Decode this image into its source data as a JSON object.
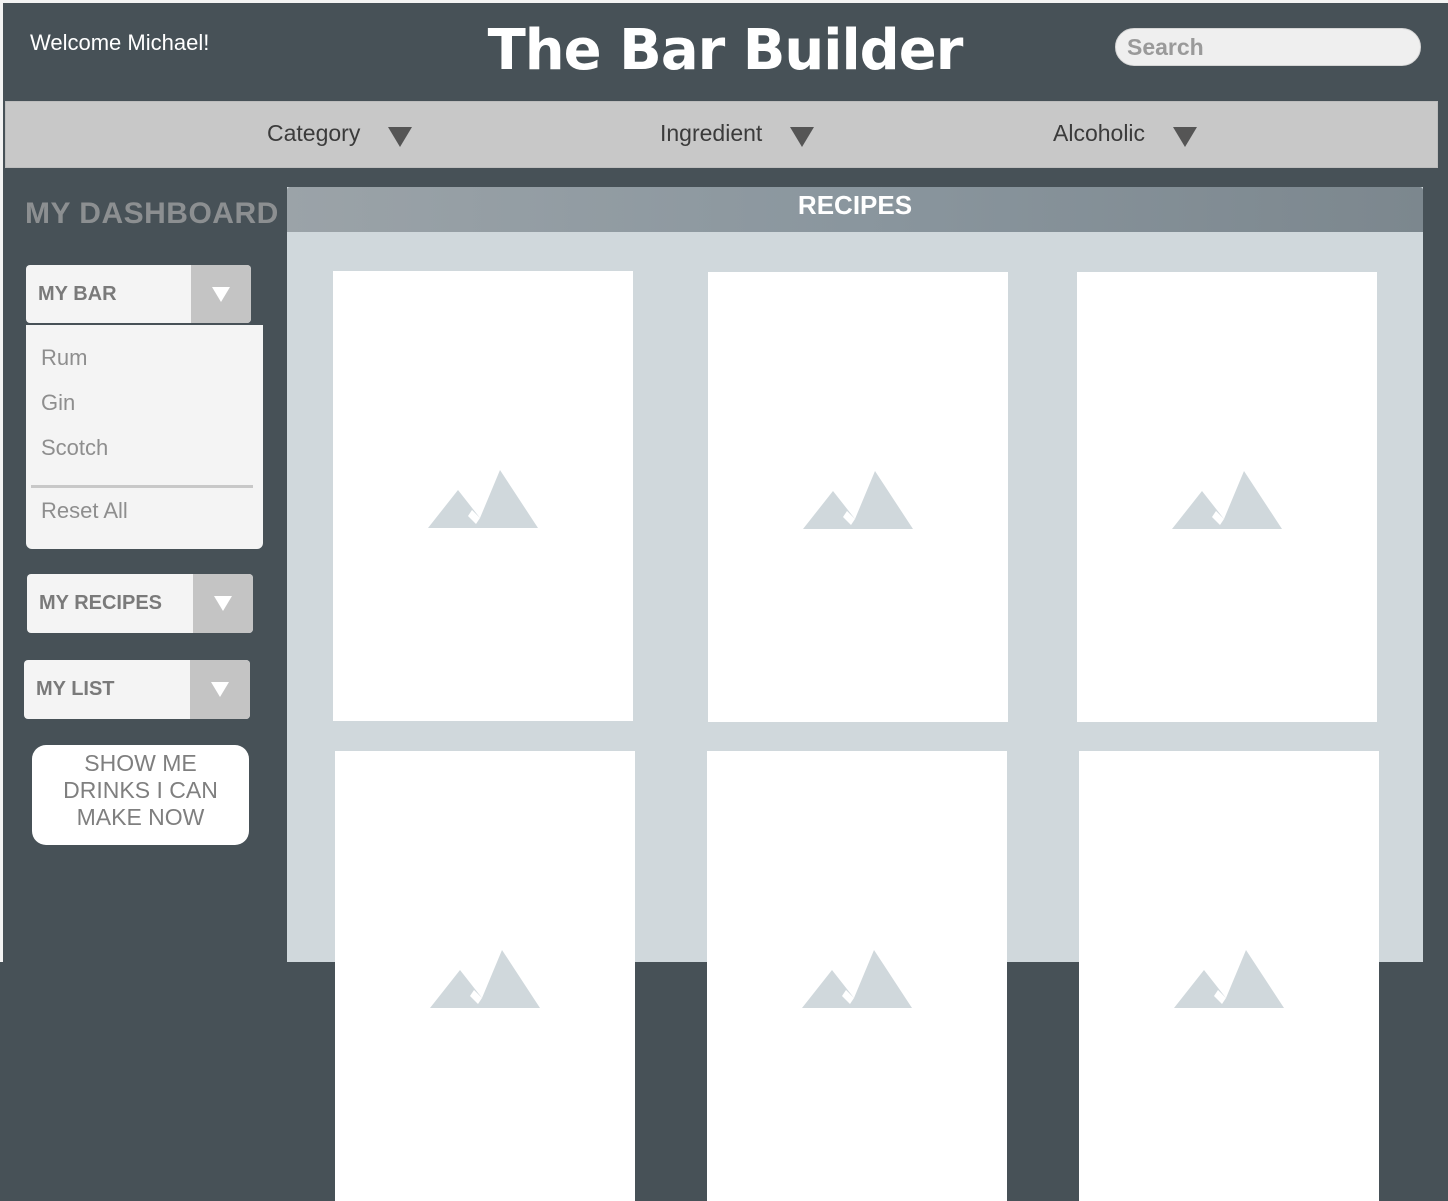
{
  "header": {
    "welcome": "Welcome Michael!",
    "title": "The Bar Builder",
    "search_placeholder": "Search"
  },
  "filters": [
    {
      "label": "Category",
      "icon": "triangle-down-icon"
    },
    {
      "label": "Ingredient",
      "icon": "triangle-down-icon"
    },
    {
      "label": "Alcoholic",
      "icon": "triangle-down-icon"
    }
  ],
  "sidebar": {
    "title": "MY DASHBOARD",
    "my_bar": {
      "label": "MY BAR",
      "items": [
        "Rum",
        "Gin",
        "Scotch"
      ],
      "reset": "Reset All"
    },
    "my_recipes": {
      "label": "MY RECIPES"
    },
    "my_list": {
      "label": "MY LIST"
    },
    "show_button": [
      "SHOW ME",
      "DRINKS I CAN",
      "MAKE NOW"
    ]
  },
  "recipes": {
    "title": "RECIPES",
    "cards": [
      {
        "image": "image-placeholder-icon"
      },
      {
        "image": "image-placeholder-icon"
      },
      {
        "image": "image-placeholder-icon"
      },
      {
        "image": "image-placeholder-icon"
      },
      {
        "image": "image-placeholder-icon"
      },
      {
        "image": "image-placeholder-icon"
      }
    ]
  },
  "colors": {
    "background": "#475157",
    "filter_bar": "#c8c8c8",
    "panel": "#d0d8dc",
    "card": "#ffffff",
    "placeholder_icon": "#d0d8dc"
  }
}
